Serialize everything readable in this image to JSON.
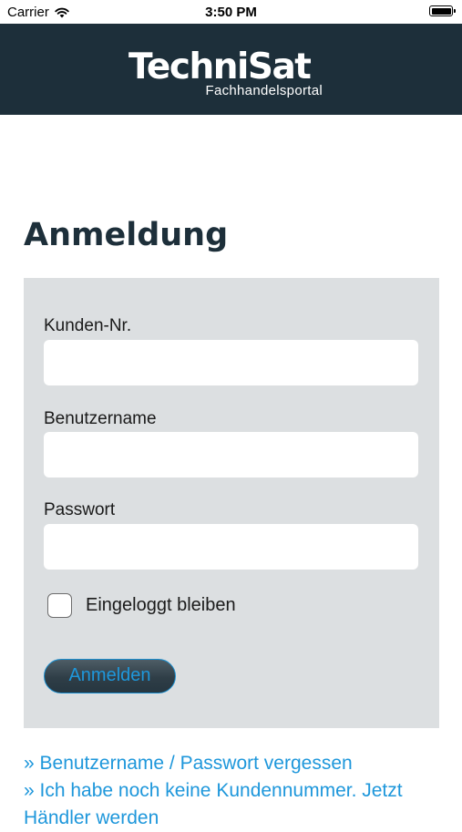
{
  "status_bar": {
    "carrier": "Carrier",
    "time": "3:50 PM"
  },
  "header": {
    "logo_brand": "TechniSat",
    "logo_subtitle": "Fachhandelsportal"
  },
  "page": {
    "title": "Anmeldung"
  },
  "form": {
    "customer_number_label": "Kunden-Nr.",
    "customer_number_value": "",
    "username_label": "Benutzername",
    "username_value": "",
    "password_label": "Passwort",
    "password_value": "",
    "remember_label": "Eingeloggt bleiben",
    "remember_checked": false,
    "submit_label": "Anmelden"
  },
  "links": {
    "forgot": "» Benutzername / Passwort vergessen",
    "register": "» Ich habe noch keine Kundennummer. Jetzt Händler werden"
  },
  "colors": {
    "header_bg": "#1d2f3a",
    "panel_bg": "#dcdfe1",
    "link": "#1e97db",
    "title": "#1d2f3a"
  },
  "icons": {
    "wifi": "wifi-icon",
    "battery": "battery-icon"
  }
}
